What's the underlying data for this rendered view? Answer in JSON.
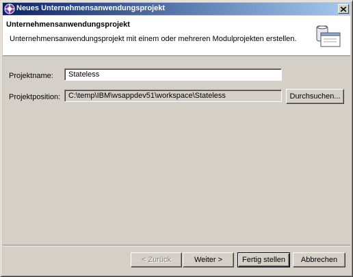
{
  "window": {
    "title": "Neues Unternehmensanwendungsprojekt",
    "icons": {
      "app": "eclipse-wizard-icon",
      "close": "close-icon",
      "banner": "enterprise-application-icon"
    }
  },
  "banner": {
    "title": "Unternehmensanwendungsprojekt",
    "description": "Unternehmensanwendungsprojekt mit einem oder mehreren Modulprojekten erstellen."
  },
  "form": {
    "name_label": "Projektname:",
    "name_value": "Stateless",
    "location_label": "Projektposition:",
    "location_value": "C:\\temp\\IBM\\wsappdev51\\workspace\\Stateless",
    "browse_button": "Durchsuchen..."
  },
  "buttons": {
    "back": "< Zurück",
    "next": "Weiter >",
    "finish": "Fertig stellen",
    "cancel": "Abbrechen"
  }
}
